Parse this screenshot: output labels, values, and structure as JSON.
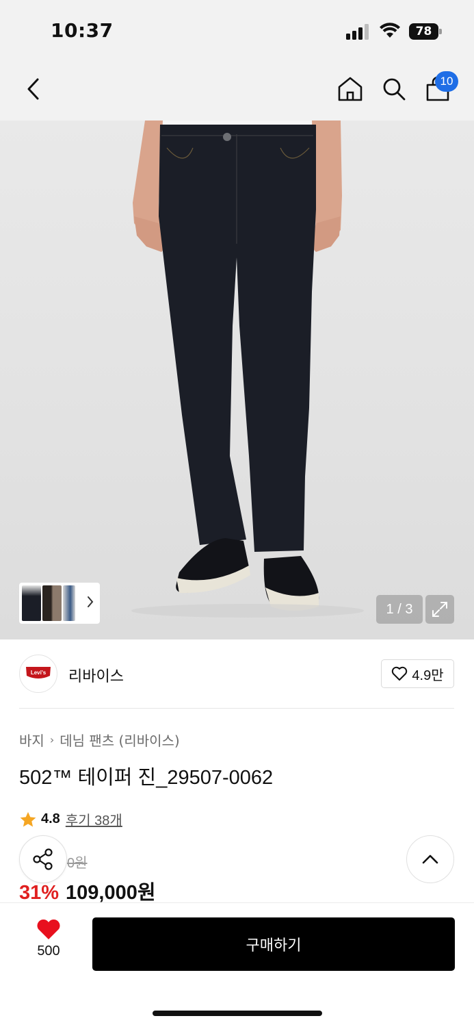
{
  "status_bar": {
    "time": "10:37",
    "battery": "78"
  },
  "header": {
    "cart_count": "10"
  },
  "gallery": {
    "counter": "1 / 3"
  },
  "brand": {
    "name": "리바이스",
    "logo_text": "Levi's",
    "like_count": "4.9만"
  },
  "breadcrumb": {
    "items": [
      "바지",
      "데님 팬츠 (리바이스)"
    ]
  },
  "product": {
    "title": "502™ 테이퍼 진_29507-0062",
    "rating": "4.8",
    "review_link": "후기 38개",
    "original_price": "0원",
    "discount": "31%",
    "price": "109,000원"
  },
  "bottom": {
    "wish_count": "500",
    "buy_label": "구매하기"
  },
  "colors": {
    "badge": "#1f6ee6",
    "discount": "#e02020",
    "heart": "#e8101e",
    "buy_button": "#000000"
  },
  "icons": [
    "back-icon",
    "home-icon",
    "search-icon",
    "cart-icon",
    "expand-icon",
    "heart-outline-icon",
    "star-icon",
    "share-icon",
    "chevron-up-icon",
    "heart-filled-icon"
  ]
}
